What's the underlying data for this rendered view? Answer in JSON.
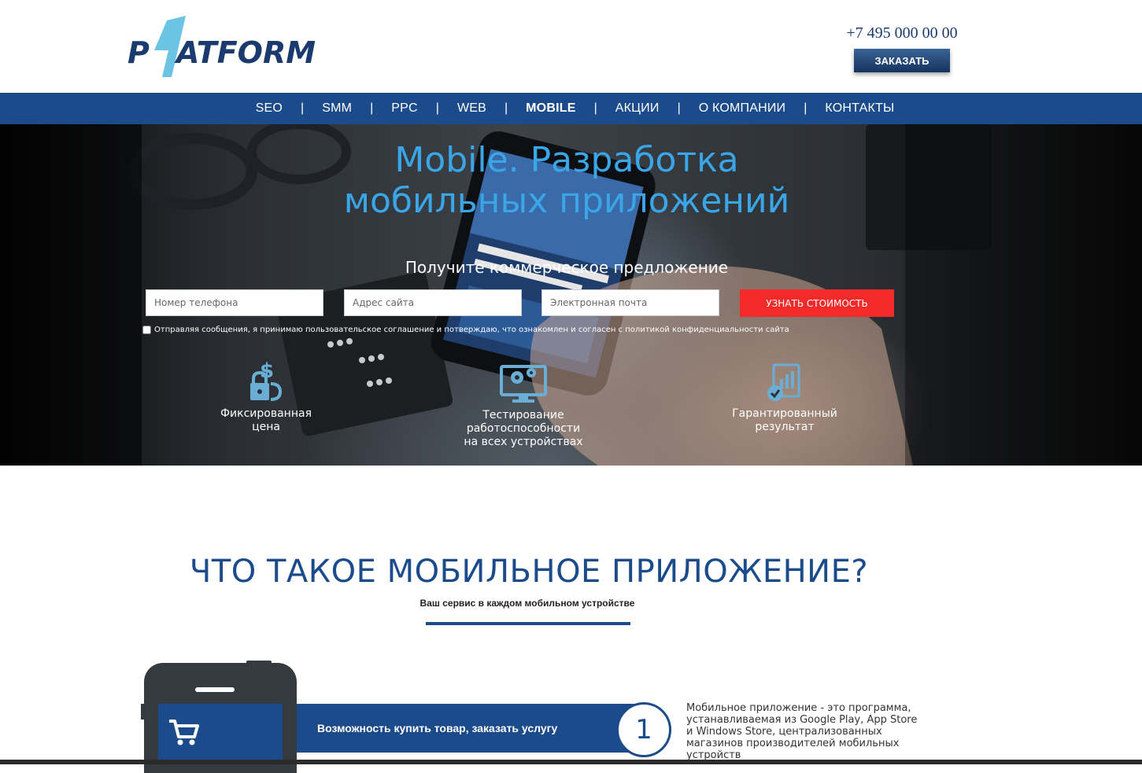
{
  "header": {
    "logo_text": "PLATFORM",
    "phone": "+7 495 000 00 00",
    "order_label": "ЗАКАЗАТЬ"
  },
  "nav": {
    "items": [
      {
        "label": "SEO"
      },
      {
        "label": "SMM"
      },
      {
        "label": "PPC"
      },
      {
        "label": "WEB"
      },
      {
        "label": "MOBILE",
        "active": true
      },
      {
        "label": "АКЦИИ"
      },
      {
        "label": "О КОМПАНИИ"
      },
      {
        "label": "КОНТАКТЫ"
      }
    ],
    "separator": "|"
  },
  "hero": {
    "title_line1": "Mobile. Разработка",
    "title_line2": "мобильных приложений",
    "subtitle": "Получите коммерческое предложение",
    "phone_placeholder": "Номер телефона",
    "site_placeholder": "Адрес сайта",
    "email_placeholder": "Электронная почта",
    "cta_label": "УЗНАТЬ СТОИМОСТЬ",
    "consent_text": "Отправляя сообщения, я принимаю пользовательское соглашение и потверждаю, что ознакомлен и согласен с политикой конфиденциальности сайта",
    "features": [
      {
        "icon": "price-lock-icon",
        "line1": "Фиксированная",
        "line2": "цена",
        "line3": ""
      },
      {
        "icon": "monitor-gear-icon",
        "line1": "Тестирование",
        "line2": "работоспособности",
        "line3": "на всех устройствах"
      },
      {
        "icon": "report-check-icon",
        "line1": "Гарантированный",
        "line2": "результат",
        "line3": ""
      }
    ]
  },
  "section": {
    "title": "ЧТО ТАКОЕ МОБИЛЬНОЕ ПРИЛОЖЕНИЕ?",
    "subtitle": "Ваш сервис в каждом мобильном устройстве",
    "feature_text": "Возможность купить товар, заказать услугу",
    "feature_number": "1",
    "feature_icon": "cart-icon",
    "description": "Мобильное приложение - это программа, устанавливаемая из Google Play, App Store и Windows Store, централизованных магазинов производителей мобильных устройств"
  },
  "colors": {
    "brand_blue": "#1b4b8a",
    "accent_light_blue": "#3aa6e8",
    "cta_red": "#f32a2a"
  }
}
